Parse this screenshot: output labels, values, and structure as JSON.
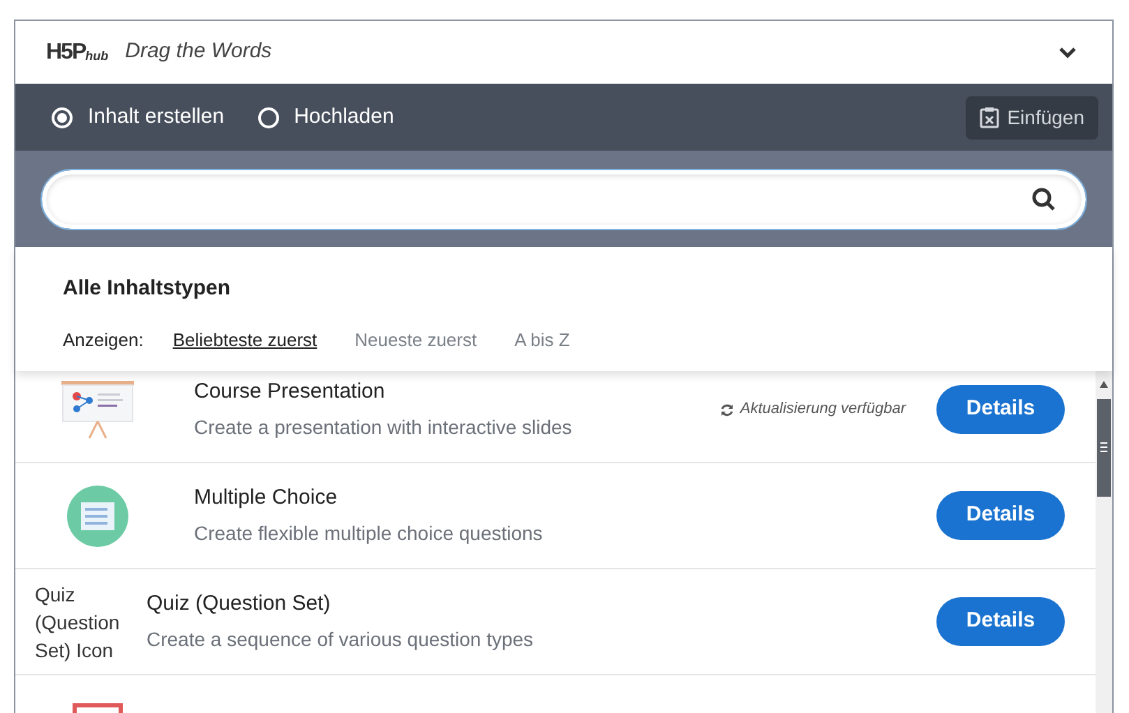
{
  "header": {
    "logo": "H5P",
    "logo_sub": "hub",
    "title": "Drag the Words",
    "expanded": true
  },
  "modes": [
    {
      "label": "Inhalt erstellen",
      "selected": true
    },
    {
      "label": "Hochladen",
      "selected": false
    }
  ],
  "paste_button": "Einfügen",
  "filter": {
    "title": "Alle Inhaltstypen",
    "show_label": "Anzeigen:",
    "sort_options": [
      {
        "label": "Beliebteste zuerst",
        "selected": true
      },
      {
        "label": "Neueste zuerst",
        "selected": false
      },
      {
        "label": "A bis Z",
        "selected": false
      }
    ]
  },
  "content_types": [
    {
      "kind": "presentation",
      "title": "Course Presentation",
      "description": "Create a presentation with interactive slides",
      "update": "Aktualisierung verfügbar",
      "button": "Details"
    },
    {
      "kind": "multichoice",
      "title": "Multiple Choice",
      "description": "Create flexible multiple choice questions",
      "button": "Details"
    },
    {
      "kind": "broken",
      "alt": "Quiz (Question Set) Icon",
      "title": "Quiz (Question Set)",
      "description": "Create a sequence of various question types",
      "button": "Details"
    },
    {
      "kind": "blanks"
    }
  ]
}
